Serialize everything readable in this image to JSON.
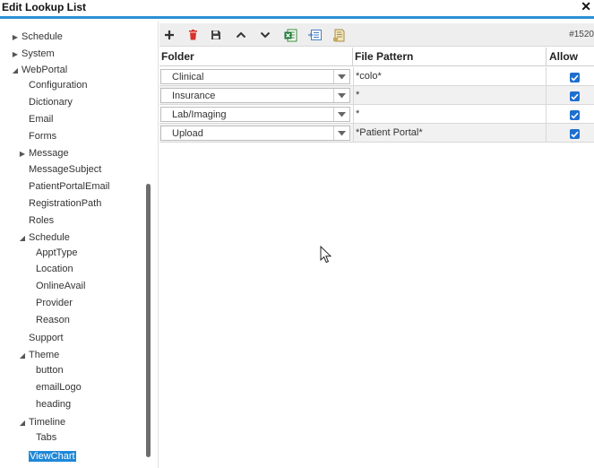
{
  "window": {
    "title": "Edit Lookup List",
    "close_glyph": "✕"
  },
  "tree": [
    {
      "label": "Schedule",
      "arrow": "collapsed"
    },
    {
      "label": "System",
      "arrow": "collapsed"
    },
    {
      "label": "WebPortal",
      "arrow": "expanded"
    },
    {
      "label": "Configuration",
      "arrow": "none"
    },
    {
      "label": "Dictionary",
      "arrow": "none"
    },
    {
      "label": "Email",
      "arrow": "none"
    },
    {
      "label": "Forms",
      "arrow": "none"
    },
    {
      "label": "Message",
      "arrow": "collapsed"
    },
    {
      "label": "MessageSubject",
      "arrow": "none"
    },
    {
      "label": "PatientPortalEmail",
      "arrow": "none"
    },
    {
      "label": "RegistrationPath",
      "arrow": "none"
    },
    {
      "label": "Roles",
      "arrow": "none"
    },
    {
      "label": "Schedule",
      "arrow": "expanded"
    },
    {
      "label": "ApptType",
      "arrow": "none"
    },
    {
      "label": "Location",
      "arrow": "none"
    },
    {
      "label": "OnlineAvail",
      "arrow": "none"
    },
    {
      "label": "Provider",
      "arrow": "none"
    },
    {
      "label": "Reason",
      "arrow": "none"
    },
    {
      "label": "Support",
      "arrow": "none"
    },
    {
      "label": "Theme",
      "arrow": "expanded"
    },
    {
      "label": "button",
      "arrow": "none"
    },
    {
      "label": "emailLogo",
      "arrow": "none"
    },
    {
      "label": "heading",
      "arrow": "none"
    },
    {
      "label": "Timeline",
      "arrow": "expanded"
    },
    {
      "label": "Tabs",
      "arrow": "none"
    },
    {
      "label": "ViewChart",
      "arrow": "none",
      "selected": true
    }
  ],
  "toolbar": {
    "buttons": [
      "add-icon",
      "delete-icon",
      "save-icon",
      "move-up-icon",
      "move-down-icon",
      "excel-export-icon",
      "import-icon",
      "report-icon"
    ],
    "count_text": "#1520"
  },
  "grid": {
    "headers": {
      "folder": "Folder",
      "pattern": "File Pattern",
      "allow": "Allow"
    },
    "rows": [
      {
        "folder": "Clinical",
        "pattern": "*colo*",
        "allow": true
      },
      {
        "folder": "Insurance",
        "pattern": "*",
        "allow": true
      },
      {
        "folder": "Lab/Imaging",
        "pattern": "*",
        "allow": true
      },
      {
        "folder": "Upload",
        "pattern": "*Patient Portal*",
        "allow": true
      }
    ]
  },
  "colors": {
    "accent": "#2b8fd6",
    "selection": "#1e88d8",
    "checkbox": "#1e6fd0",
    "delete": "#d9302c"
  }
}
